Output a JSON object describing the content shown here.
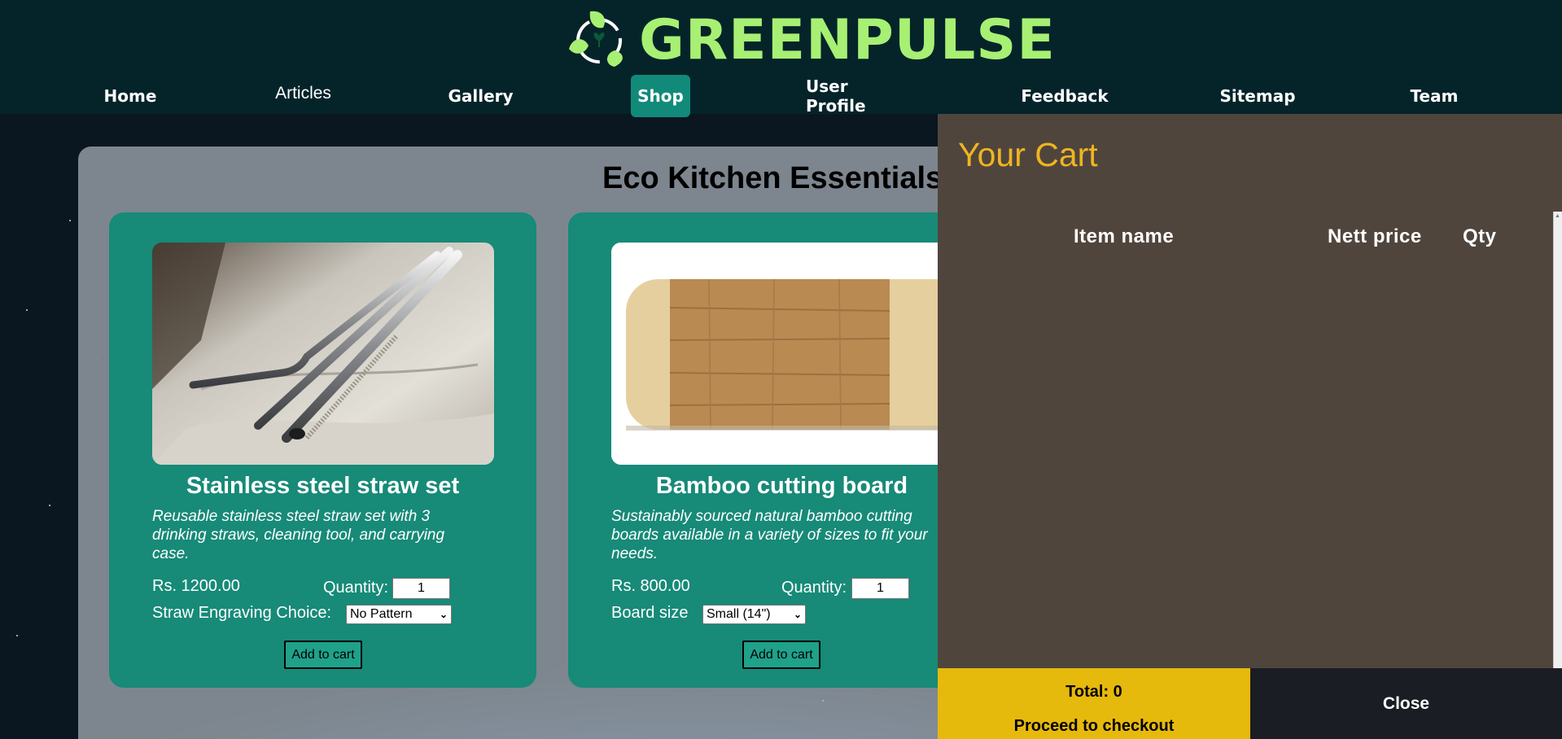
{
  "brand": {
    "name": "GREENPULSE"
  },
  "nav": {
    "items": [
      {
        "label": "Home"
      },
      {
        "label": "Articles"
      },
      {
        "label": "Gallery"
      },
      {
        "label": "Shop"
      },
      {
        "label": "User Profile"
      },
      {
        "label": "Feedback"
      },
      {
        "label": "Sitemap"
      },
      {
        "label": "Team"
      }
    ],
    "active": "Shop"
  },
  "shop": {
    "title": "Eco Kitchen Essentials",
    "products": [
      {
        "name": "Stainless steel straw set",
        "description": "Reusable stainless steel straw set with 3 drinking straws, cleaning tool, and carrying case.",
        "price": "Rs. 1200.00",
        "quantity_label": "Quantity:",
        "quantity": "1",
        "option_label": "Straw Engraving Choice:",
        "option_selected": "No Pattern",
        "add_label": "Add to cart"
      },
      {
        "name": "Bamboo cutting board",
        "description": "Sustainably sourced natural bamboo cutting boards available in a variety of sizes to fit your needs.",
        "price": "Rs. 800.00",
        "quantity_label": "Quantity:",
        "quantity": "1",
        "option_label": "Board size",
        "option_selected": "Small (14\")",
        "add_label": "Add to cart"
      }
    ]
  },
  "cart": {
    "title": "Your Cart",
    "columns": [
      "Item name",
      "Nett price",
      "Qty"
    ],
    "total": "Total: 0",
    "checkout_label": "Proceed to checkout",
    "close_label": "Close"
  },
  "colors": {
    "header_bg": "#04242a",
    "brand": "#a7f073",
    "card_bg": "#178a78",
    "cart_bg": "#50453d",
    "cart_title": "#f0b520",
    "checkout_bg": "#e6b90d",
    "close_bg": "#1b1d25"
  }
}
